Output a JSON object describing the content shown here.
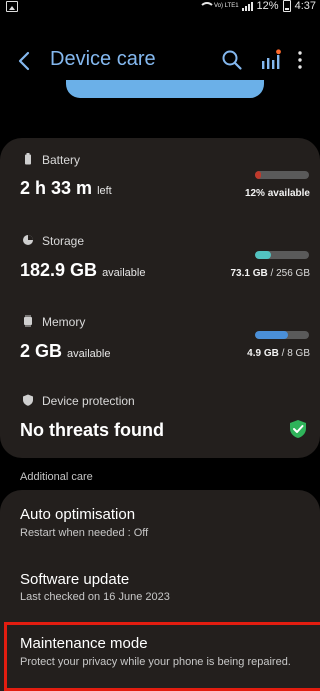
{
  "status_bar": {
    "battery_percent": "12%",
    "time": "4:37",
    "network_label": "Vo) LTE1"
  },
  "header": {
    "title": "Device care"
  },
  "battery": {
    "label": "Battery",
    "hours": "2 h 33 m",
    "suffix": "left",
    "note_value": "12%",
    "note_tail": "available",
    "fill": 0.12,
    "fill_color": "#c0392b"
  },
  "storage": {
    "label": "Storage",
    "value": "182.9 GB",
    "suffix": "available",
    "used": "73.1 GB",
    "total": "256 GB",
    "fill": 0.29,
    "fill_color": "#52c2c0"
  },
  "memory": {
    "label": "Memory",
    "value": "2 GB",
    "suffix": "available",
    "used": "4.9 GB",
    "total": "8 GB",
    "fill": 0.61,
    "fill_color": "#4a8fd8"
  },
  "protection": {
    "label": "Device protection",
    "status": "No threats found"
  },
  "additional": {
    "heading": "Additional care"
  },
  "items": [
    {
      "title": "Auto optimisation",
      "subtitle": "Restart when needed : Off"
    },
    {
      "title": "Software update",
      "subtitle": "Last checked on 16 June 2023"
    },
    {
      "title": "Maintenance mode",
      "subtitle": "Protect your privacy while your phone is being repaired."
    }
  ],
  "colors": {
    "accent": "#84b8ef",
    "card": "#231f1d",
    "highlight": "#e21d10",
    "shield": "#2fb35a"
  }
}
